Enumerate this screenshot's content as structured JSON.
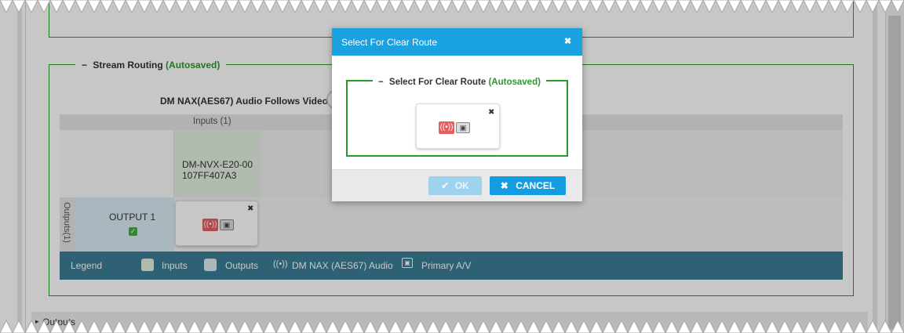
{
  "stream_routing": {
    "title": "Stream Routing",
    "autosaved": "(Autosaved)",
    "collapse_glyph": "−",
    "follows_video_label": "DM NAX(AES67) Audio Follows Video",
    "inputs_header": "Inputs (1)",
    "outputs_header": "Outputs(1)",
    "input_name_line1": "DM-NVX-E20-00",
    "input_name_line2": "107FF407A3",
    "output_name": "OUTPUT 1",
    "output_checked": true,
    "route_tile": {
      "close_glyph": "✖",
      "icons": [
        "nax-audio-icon",
        "primary-av-icon"
      ]
    }
  },
  "legend": {
    "label": "Legend",
    "inputs": "Inputs",
    "outputs": "Outputs",
    "nax_audio": "DM NAX (AES67) Audio",
    "primary_av": "Primary A/V",
    "colors": {
      "inputs": "#e3f0e0",
      "outputs": "#dcebf4",
      "bar": "#3d7d95"
    }
  },
  "outputs_section": {
    "label": "Outputs",
    "expand_glyph": "▸"
  },
  "modal": {
    "title": "Select For Clear Route",
    "close_glyph": "✖",
    "section_title": "Select For Clear Route",
    "autosaved": "(Autosaved)",
    "collapse_glyph": "−",
    "tile_close_glyph": "✖",
    "ok_label": "OK",
    "ok_glyph": "✔",
    "cancel_label": "CANCEL",
    "cancel_glyph": "✖",
    "colors": {
      "header": "#19a1e0",
      "ok": "#9fd2ee",
      "cancel": "#149ce0",
      "fieldset": "#2a9a2a"
    }
  }
}
